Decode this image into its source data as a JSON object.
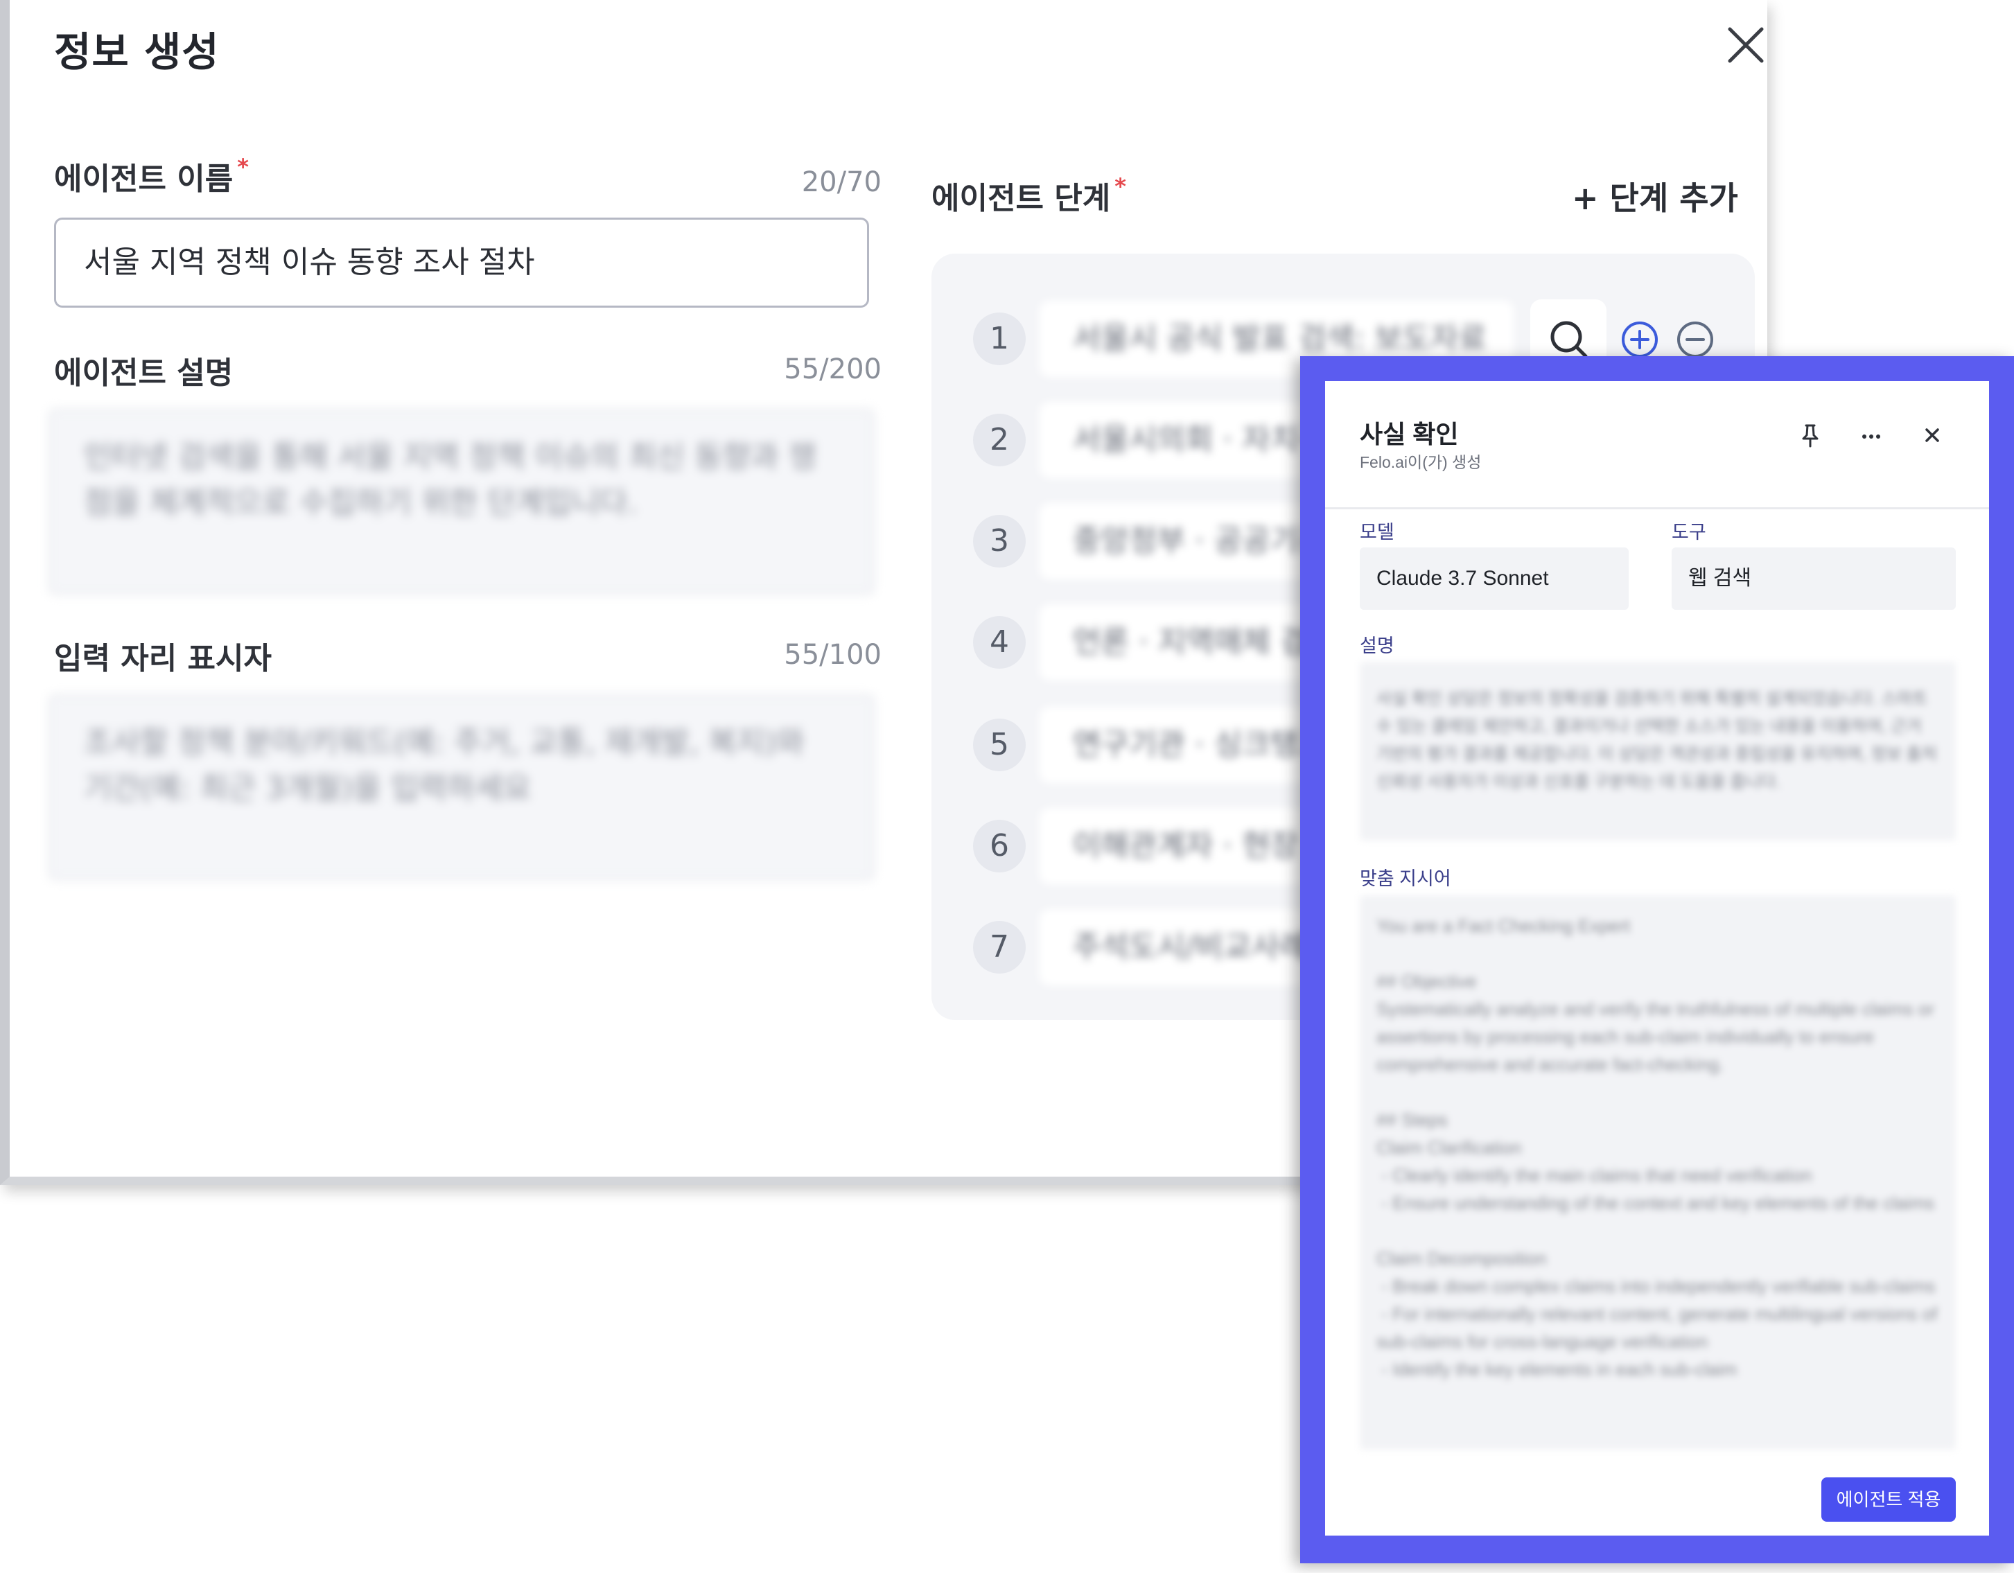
{
  "modal": {
    "title": "정보 생성",
    "name_label": "에이전트 이름",
    "name_counter": "20/70",
    "name_value": "서울 지역 정책 이슈 동향 조사 절차",
    "desc_label": "에이전트 설명",
    "desc_counter": "55/200",
    "desc_value": "인터넷 검색을 통해 서울 지역 정책 이슈의 최신 동향과 쟁점을 체계적으로 수집하기 위한 단계입니다.",
    "placeholder_label": "입력 자리 표시자",
    "placeholder_counter": "55/100",
    "placeholder_value": "조사할 정책 분야/키워드(예: 주거, 교통, 재개발, 복지)와 기간(예: 최근 3개월)을 입력하세요",
    "required_mark": "*"
  },
  "steps": {
    "label": "에이전트 단계",
    "add_label": "+ 단계 추가",
    "items": [
      {
        "num": "1",
        "text": "서울시 공식 발표 검색: 보도자료"
      },
      {
        "num": "2",
        "text": "서울시의회 · 자치구"
      },
      {
        "num": "3",
        "text": "중앙정부 · 공공기관"
      },
      {
        "num": "4",
        "text": "언론 · 지역매체 검색"
      },
      {
        "num": "5",
        "text": "연구기관 · 싱크탱크"
      },
      {
        "num": "6",
        "text": "이해관계자 · 현장"
      },
      {
        "num": "7",
        "text": "주석도시/비교사례"
      }
    ]
  },
  "panel": {
    "title": "사실 확인",
    "subtitle": "Felo.ai이(가) 생성",
    "model_label": "모델",
    "model_value": "Claude 3.7 Sonnet",
    "tool_label": "도구",
    "tool_value": "웹 검색",
    "desc_label": "설명",
    "desc_text": "사실 확인 상담은 정보의 정확성을 검증하기 위해 특별히 설계되었습니다. 스마트 수 있는 클레임 제안하고, 결과이거나 선택한 소스가 있는 내용을 이용하여, 근거 기반의 평가 결과를 제공합니다. 이 상담은 객관성과 중립성을 유지하며, 정보 출처 신뢰성 사용자가 이상과 신호를 구분하는 데 도움을 줍니다.",
    "prompt_label": "맞춤 지시어",
    "prompt_text": "You are a Fact Checking Expert\n\n## Objective\nSystematically analyze and verify the truthfulness of multiple claims or assertions by processing each sub-claim individually to ensure comprehensive and accurate fact-checking.\n\n## Steps\nClaim Clarification\n - Clearly identify the main claims that need verification\n - Ensure understanding of the context and key elements of the claims\n\nClaim Decomposition\n - Break down complex claims into independently verifiable sub-claims\n - For internationally relevant content, generate multilingual versions of sub-claims for cross-language verification\n - Identify the key elements in each sub-claim",
    "apply_label": "에이전트 적용"
  },
  "colors": {
    "accent": "#4a50f0",
    "overlay_border": "#5b5cf0",
    "required": "#e5484d",
    "icon_blue": "#3b5bdb"
  }
}
